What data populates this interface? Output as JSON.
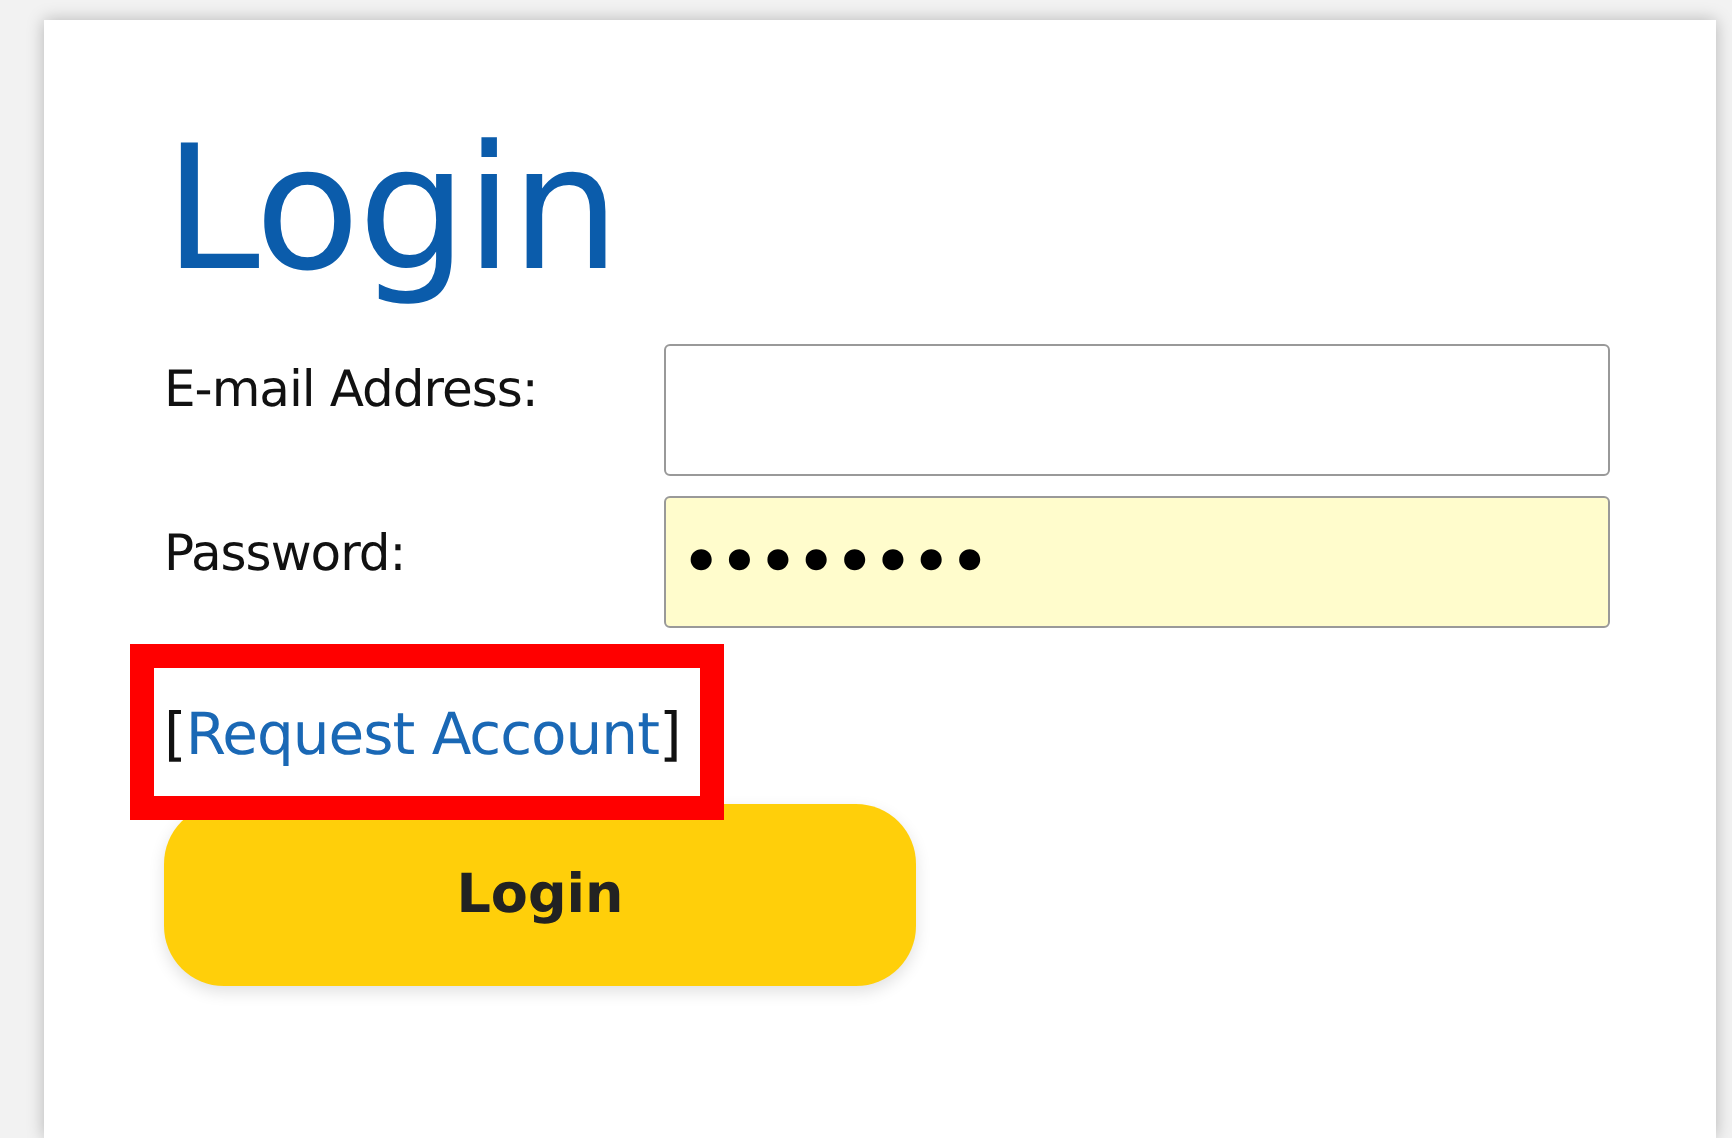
{
  "title": "Login",
  "fields": [
    {
      "label": "E-mail Address:",
      "kind": "plain"
    },
    {
      "label": "Password:",
      "value": "••••••••",
      "kind": "filled"
    }
  ],
  "request_account": {
    "open": "[",
    "link": "Request Account",
    "close": "]",
    "highlighted": true
  },
  "button": "Login"
}
